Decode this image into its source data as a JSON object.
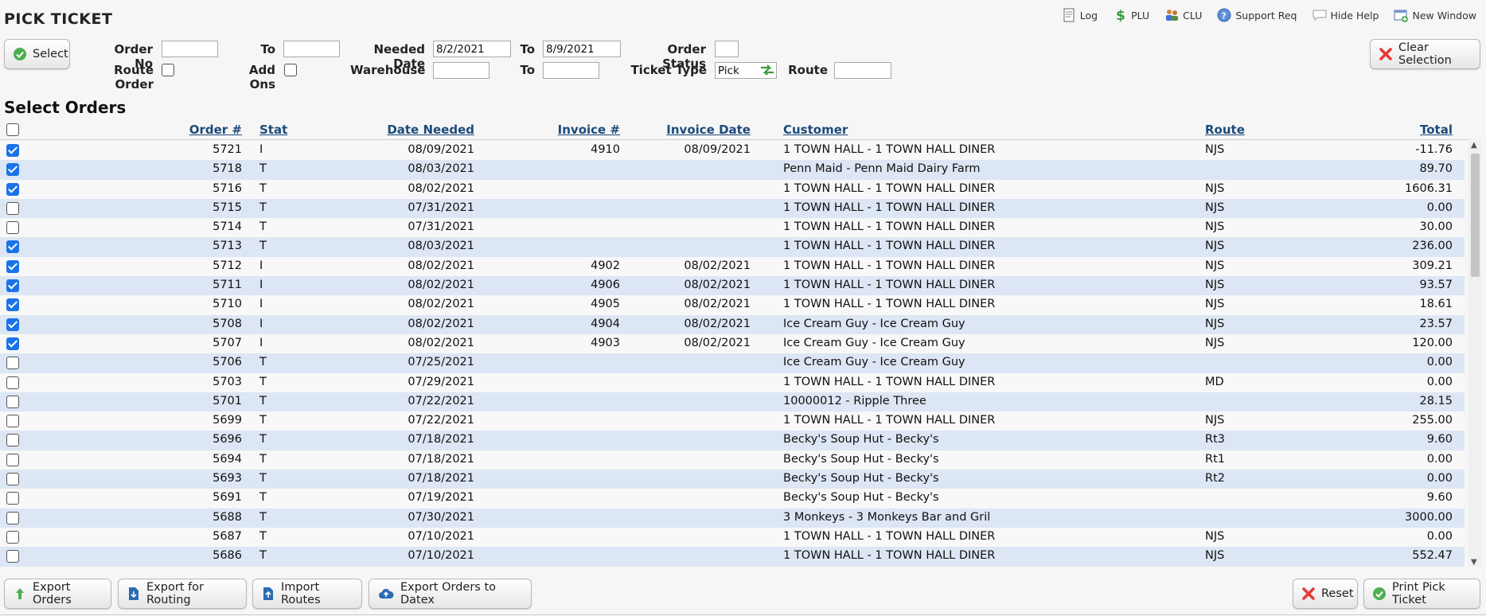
{
  "app": {
    "title": "PICK TICKET"
  },
  "toplinks": [
    {
      "name": "log",
      "label": "Log",
      "icon": "log-icon"
    },
    {
      "name": "plu",
      "label": "PLU",
      "icon": "dollar-icon"
    },
    {
      "name": "clu",
      "label": "CLU",
      "icon": "customers-icon"
    },
    {
      "name": "support",
      "label": "Support Req",
      "icon": "help-icon"
    },
    {
      "name": "hide-help",
      "label": "Hide Help",
      "icon": "speech-bubble-icon"
    },
    {
      "name": "new-window",
      "label": "New Window",
      "icon": "new-window-icon"
    }
  ],
  "buttons": {
    "select": "Select",
    "clear_selection": "Clear Selection",
    "export_orders": "Export Orders",
    "export_routing": "Export for Routing",
    "import_routes": "Import Routes",
    "export_datex": "Export Orders to Datex",
    "reset": "Reset",
    "print_pick_ticket": "Print Pick Ticket"
  },
  "filters": {
    "order_no_label": "Order No",
    "order_no": "",
    "to_label": "To",
    "order_to": "",
    "needed_date_label": "Needed Date",
    "needed_date_from": "8/2/2021",
    "needed_date_to_label": "To",
    "needed_date_to": "8/9/2021",
    "order_status_label": "Order Status",
    "order_status": "",
    "route_order_label": "Route Order",
    "add_ons_label": "Add Ons",
    "warehouse_label": "Warehouse",
    "warehouse_from": "",
    "warehouse_to_label": "To",
    "warehouse_to": "",
    "ticket_type_label": "Ticket Type",
    "ticket_type": "Pick",
    "route_label": "Route",
    "route": ""
  },
  "section_title": "Select Orders",
  "table": {
    "columns": {
      "order": "Order #",
      "stat": "Stat",
      "date_needed": "Date Needed",
      "invoice": "Invoice #",
      "invoice_date": "Invoice Date",
      "customer": "Customer",
      "route": "Route",
      "total": "Total"
    },
    "rows": [
      {
        "checked": true,
        "order": "5721",
        "stat": "I",
        "date_needed": "08/09/2021",
        "invoice": "4910",
        "invoice_date": "08/09/2021",
        "customer": "1 TOWN HALL - 1 TOWN HALL DINER",
        "route": "NJS",
        "total": "-11.76"
      },
      {
        "checked": true,
        "order": "5718",
        "stat": "T",
        "date_needed": "08/03/2021",
        "invoice": "",
        "invoice_date": "",
        "customer": "Penn Maid - Penn Maid Dairy Farm",
        "route": "",
        "total": "89.70"
      },
      {
        "checked": true,
        "order": "5716",
        "stat": "T",
        "date_needed": "08/02/2021",
        "invoice": "",
        "invoice_date": "",
        "customer": "1 TOWN HALL - 1 TOWN HALL DINER",
        "route": "NJS",
        "total": "1606.31"
      },
      {
        "checked": false,
        "order": "5715",
        "stat": "T",
        "date_needed": "07/31/2021",
        "invoice": "",
        "invoice_date": "",
        "customer": "1 TOWN HALL - 1 TOWN HALL DINER",
        "route": "NJS",
        "total": "0.00"
      },
      {
        "checked": false,
        "order": "5714",
        "stat": "T",
        "date_needed": "07/31/2021",
        "invoice": "",
        "invoice_date": "",
        "customer": "1 TOWN HALL - 1 TOWN HALL DINER",
        "route": "NJS",
        "total": "30.00"
      },
      {
        "checked": true,
        "order": "5713",
        "stat": "T",
        "date_needed": "08/03/2021",
        "invoice": "",
        "invoice_date": "",
        "customer": "1 TOWN HALL - 1 TOWN HALL DINER",
        "route": "NJS",
        "total": "236.00"
      },
      {
        "checked": true,
        "order": "5712",
        "stat": "I",
        "date_needed": "08/02/2021",
        "invoice": "4902",
        "invoice_date": "08/02/2021",
        "customer": "1 TOWN HALL - 1 TOWN HALL DINER",
        "route": "NJS",
        "total": "309.21"
      },
      {
        "checked": true,
        "order": "5711",
        "stat": "I",
        "date_needed": "08/02/2021",
        "invoice": "4906",
        "invoice_date": "08/02/2021",
        "customer": "1 TOWN HALL - 1 TOWN HALL DINER",
        "route": "NJS",
        "total": "93.57"
      },
      {
        "checked": true,
        "order": "5710",
        "stat": "I",
        "date_needed": "08/02/2021",
        "invoice": "4905",
        "invoice_date": "08/02/2021",
        "customer": "1 TOWN HALL - 1 TOWN HALL DINER",
        "route": "NJS",
        "total": "18.61"
      },
      {
        "checked": true,
        "order": "5708",
        "stat": "I",
        "date_needed": "08/02/2021",
        "invoice": "4904",
        "invoice_date": "08/02/2021",
        "customer": "Ice Cream Guy - Ice Cream Guy",
        "route": "NJS",
        "total": "23.57"
      },
      {
        "checked": true,
        "order": "5707",
        "stat": "I",
        "date_needed": "08/02/2021",
        "invoice": "4903",
        "invoice_date": "08/02/2021",
        "customer": "Ice Cream Guy - Ice Cream Guy",
        "route": "NJS",
        "total": "120.00"
      },
      {
        "checked": false,
        "order": "5706",
        "stat": "T",
        "date_needed": "07/25/2021",
        "invoice": "",
        "invoice_date": "",
        "customer": "Ice Cream Guy - Ice Cream Guy",
        "route": "",
        "total": "0.00"
      },
      {
        "checked": false,
        "order": "5703",
        "stat": "T",
        "date_needed": "07/29/2021",
        "invoice": "",
        "invoice_date": "",
        "customer": "1 TOWN HALL - 1 TOWN HALL DINER",
        "route": "MD",
        "total": "0.00"
      },
      {
        "checked": false,
        "order": "5701",
        "stat": "T",
        "date_needed": "07/22/2021",
        "invoice": "",
        "invoice_date": "",
        "customer": "10000012 - Ripple Three",
        "route": "",
        "total": "28.15"
      },
      {
        "checked": false,
        "order": "5699",
        "stat": "T",
        "date_needed": "07/22/2021",
        "invoice": "",
        "invoice_date": "",
        "customer": "1 TOWN HALL - 1 TOWN HALL DINER",
        "route": "NJS",
        "total": "255.00"
      },
      {
        "checked": false,
        "order": "5696",
        "stat": "T",
        "date_needed": "07/18/2021",
        "invoice": "",
        "invoice_date": "",
        "customer": "Becky's Soup Hut - Becky's",
        "route": "Rt3",
        "total": "9.60"
      },
      {
        "checked": false,
        "order": "5694",
        "stat": "T",
        "date_needed": "07/18/2021",
        "invoice": "",
        "invoice_date": "",
        "customer": "Becky's Soup Hut - Becky's",
        "route": "Rt1",
        "total": "0.00"
      },
      {
        "checked": false,
        "order": "5693",
        "stat": "T",
        "date_needed": "07/18/2021",
        "invoice": "",
        "invoice_date": "",
        "customer": "Becky's Soup Hut - Becky's",
        "route": "Rt2",
        "total": "0.00"
      },
      {
        "checked": false,
        "order": "5691",
        "stat": "T",
        "date_needed": "07/19/2021",
        "invoice": "",
        "invoice_date": "",
        "customer": "Becky's Soup Hut - Becky's",
        "route": "",
        "total": "9.60"
      },
      {
        "checked": false,
        "order": "5688",
        "stat": "T",
        "date_needed": "07/30/2021",
        "invoice": "",
        "invoice_date": "",
        "customer": "3 Monkeys - 3 Monkeys Bar and Gril",
        "route": "",
        "total": "3000.00"
      },
      {
        "checked": false,
        "order": "5687",
        "stat": "T",
        "date_needed": "07/10/2021",
        "invoice": "",
        "invoice_date": "",
        "customer": "1 TOWN HALL - 1 TOWN HALL DINER",
        "route": "NJS",
        "total": "0.00"
      },
      {
        "checked": false,
        "order": "5686",
        "stat": "T",
        "date_needed": "07/10/2021",
        "invoice": "",
        "invoice_date": "",
        "customer": "1 TOWN HALL - 1 TOWN HALL DINER",
        "route": "NJS",
        "total": "552.47"
      }
    ]
  },
  "colors": {
    "link": "#1d4a7a",
    "row_alt": "#dde6f4",
    "checkbox_on": "#1a73e8",
    "green_icon": "#4caf50",
    "red_icon": "#e53935"
  }
}
